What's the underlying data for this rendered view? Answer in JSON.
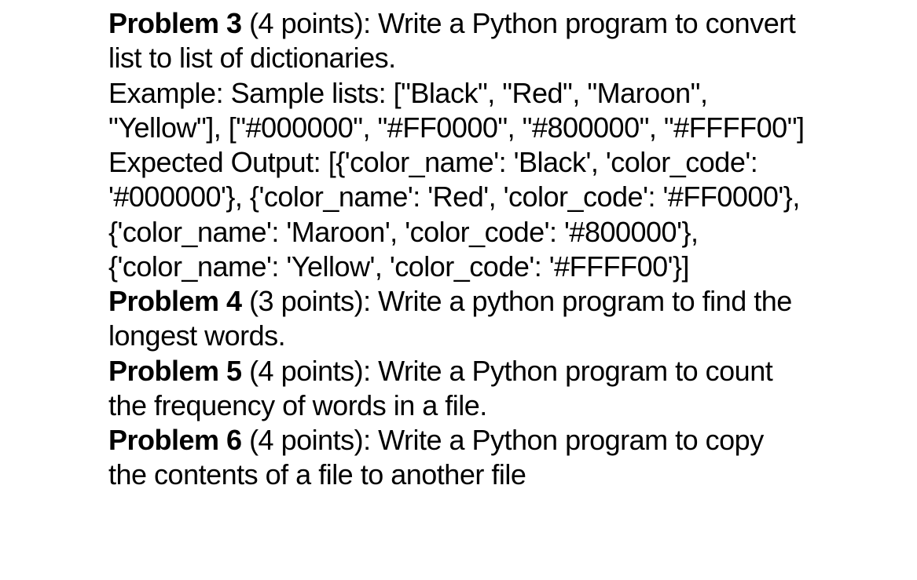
{
  "problems": {
    "p3": {
      "title": "Problem 3",
      "points": " (4 points): ",
      "desc": "Write a Python program to convert list to list of dictionaries.",
      "example_label": "Example: Sample lists: ",
      "example_value": "[\"Black\", \"Red\", \"Maroon\", \"Yellow\"], [\"#000000\", \"#FF0000\", \"#800000\", \"#FFFF00\"]",
      "expected_label": "Expected Output: ",
      "expected_value": "[{'color_name': 'Black', 'color_code': '#000000'}, {'color_name': 'Red', 'color_code': '#FF0000'}, {'color_name': 'Maroon', 'color_code': '#800000'}, {'color_name': 'Yellow', 'color_code': '#FFFF00'}]"
    },
    "p4": {
      "title": "Problem 4",
      "points": " (3 points): ",
      "desc": "Write a python program to find the longest words."
    },
    "p5": {
      "title": "Problem 5",
      "points": " (4 points): ",
      "desc": "Write a Python program to count the frequency of words in a file."
    },
    "p6": {
      "title": "Problem 6",
      "points": " (4 points): ",
      "desc": "Write a Python program to copy the contents of a file to another file"
    }
  }
}
